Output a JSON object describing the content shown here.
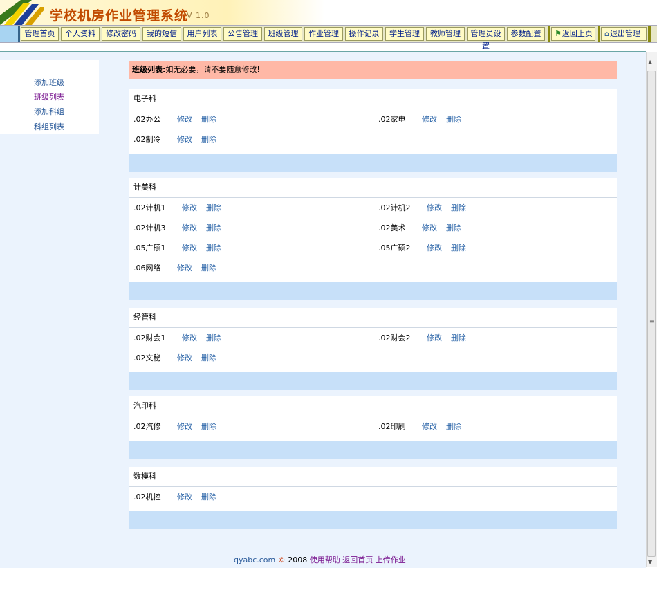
{
  "header": {
    "title": "学校机房作业管理系统",
    "version": "V 1.0"
  },
  "nav": {
    "items": [
      "管理首页",
      "个人资料",
      "修改密码",
      "我的短信",
      "用户列表",
      "公告管理",
      "班级管理",
      "作业管理",
      "操作记录",
      "学生管理",
      "教师管理",
      "管理员设置",
      "参数配置"
    ],
    "back": "返回上页",
    "logout": "退出管理"
  },
  "sidebar": {
    "items": [
      "添加班级",
      "班级列表",
      "添加科组",
      "科组列表"
    ]
  },
  "notice": {
    "label": "班级列表:",
    "text": "如无必要，请不要随意修改!"
  },
  "actions": {
    "edit": "修改",
    "delete": "删除"
  },
  "groups": [
    {
      "name": "电子科",
      "classes": [
        ".02办公",
        ".02家电",
        ".02制冷"
      ]
    },
    {
      "name": "计美科",
      "classes": [
        ".02计机1",
        ".02计机2",
        ".02计机3",
        ".02美术",
        ".05广硕1",
        ".05广硕2",
        ".06网络"
      ]
    },
    {
      "name": "经管科",
      "classes": [
        ".02财会1",
        ".02财会2",
        ".02文秘"
      ]
    },
    {
      "name": "汽印科",
      "classes": [
        ".02汽修",
        ".02印刷"
      ]
    },
    {
      "name": "数模科",
      "classes": [
        ".02机控"
      ]
    }
  ],
  "footer": {
    "site": "qyabc.com",
    "copyright": "©",
    "year": "2008",
    "links": [
      "使用帮助",
      "返回首页",
      "上传作业"
    ]
  }
}
